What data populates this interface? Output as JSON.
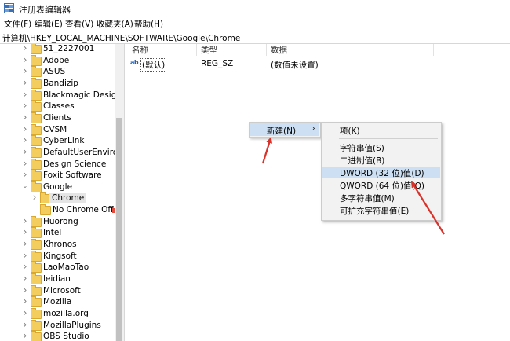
{
  "window": {
    "title": "注册表编辑器",
    "icon": "regedit-icon"
  },
  "menu": [
    "文件(F)",
    "编辑(E)",
    "查看(V)",
    "收藏夹(A)",
    "帮助(H)"
  ],
  "address": "计算机\\HKEY_LOCAL_MACHINE\\SOFTWARE\\Google\\Chrome",
  "tree": [
    {
      "label": "51_2227001",
      "level": 1,
      "expanded": false
    },
    {
      "label": "Adobe",
      "level": 1,
      "expanded": false
    },
    {
      "label": "ASUS",
      "level": 1,
      "expanded": false
    },
    {
      "label": "Bandizip",
      "level": 1,
      "expanded": false
    },
    {
      "label": "Blackmagic Design",
      "level": 1,
      "expanded": false
    },
    {
      "label": "Classes",
      "level": 1,
      "expanded": false
    },
    {
      "label": "Clients",
      "level": 1,
      "expanded": false
    },
    {
      "label": "CVSM",
      "level": 1,
      "expanded": false
    },
    {
      "label": "CyberLink",
      "level": 1,
      "expanded": false
    },
    {
      "label": "DefaultUserEnvironme",
      "level": 1,
      "expanded": false
    },
    {
      "label": "Design Science",
      "level": 1,
      "expanded": false
    },
    {
      "label": "Foxit Software",
      "level": 1,
      "expanded": false
    },
    {
      "label": "Google",
      "level": 1,
      "expanded": true
    },
    {
      "label": "Chrome",
      "level": 2,
      "expanded": false,
      "selected": true
    },
    {
      "label": "No Chrome Offer",
      "level": 2,
      "expanded": false,
      "no_chevron": true
    },
    {
      "label": "Huorong",
      "level": 1,
      "expanded": false
    },
    {
      "label": "Intel",
      "level": 1,
      "expanded": false
    },
    {
      "label": "Khronos",
      "level": 1,
      "expanded": false
    },
    {
      "label": "Kingsoft",
      "level": 1,
      "expanded": false
    },
    {
      "label": "LaoMaoTao",
      "level": 1,
      "expanded": false
    },
    {
      "label": "leidian",
      "level": 1,
      "expanded": false
    },
    {
      "label": "Microsoft",
      "level": 1,
      "expanded": false
    },
    {
      "label": "Mozilla",
      "level": 1,
      "expanded": false
    },
    {
      "label": "mozilla.org",
      "level": 1,
      "expanded": false
    },
    {
      "label": "MozillaPlugins",
      "level": 1,
      "expanded": false
    },
    {
      "label": "OBS Studio",
      "level": 1,
      "expanded": false
    }
  ],
  "columns": {
    "name": "名称",
    "type": "类型",
    "data": "数据"
  },
  "values": [
    {
      "icon_text": "ab",
      "name": "(默认)",
      "type": "REG_SZ",
      "data": "(数值未设置)"
    }
  ],
  "context_menu": {
    "label": "新建(N)",
    "arrow": "›"
  },
  "submenu": [
    {
      "label": "项(K)",
      "highlight": false
    },
    {
      "label": "字符串值(S)",
      "highlight": false
    },
    {
      "label": "二进制值(B)",
      "highlight": false
    },
    {
      "label": "DWORD (32 位)值(D)",
      "highlight": true
    },
    {
      "label": "QWORD (64 位)值(Q)",
      "highlight": false
    },
    {
      "label": "多字符串值(M)",
      "highlight": false
    },
    {
      "label": "可扩充字符串值(E)",
      "highlight": false
    }
  ],
  "colors": {
    "highlight": "#ccdff3",
    "arrow": "#d9322b",
    "folder": "#f3ce5e"
  }
}
